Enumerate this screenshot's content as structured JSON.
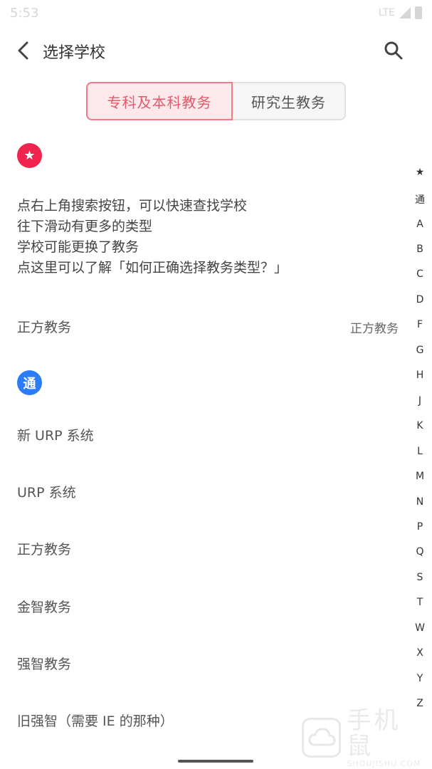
{
  "status_bar": {
    "time": "5:53",
    "network": "LTE"
  },
  "app_bar": {
    "title": "选择学校"
  },
  "tabs": [
    {
      "label": "专科及本科教务",
      "active": true
    },
    {
      "label": "研究生教务",
      "active": false
    }
  ],
  "sections": {
    "favorites_badge": "★",
    "general_badge": "通"
  },
  "tips": [
    "点右上角搜索按钮，可以快速查找学校",
    "往下滑动有更多的类型",
    "学校可能更换了教务",
    "点这里可以了解「如何正确选择教务类型？」"
  ],
  "favorite_item": {
    "name": "正方教务",
    "type": "正方教务"
  },
  "general_items": [
    "新 URP 系统",
    "URP 系统",
    "正方教务",
    "金智教务",
    "强智教务",
    "旧强智（需要 IE 的那种）"
  ],
  "index": [
    "★",
    "通",
    "A",
    "B",
    "C",
    "D",
    "F",
    "G",
    "H",
    "J",
    "K",
    "L",
    "M",
    "N",
    "P",
    "Q",
    "S",
    "T",
    "W",
    "X",
    "Y",
    "Z"
  ],
  "watermark": {
    "title": "手机鼠",
    "subtitle": "SHOUJISHU.COM"
  },
  "colors": {
    "accent": "#ef7a88",
    "favorites_badge": "#f0244f",
    "general_badge": "#2b7cf6"
  }
}
